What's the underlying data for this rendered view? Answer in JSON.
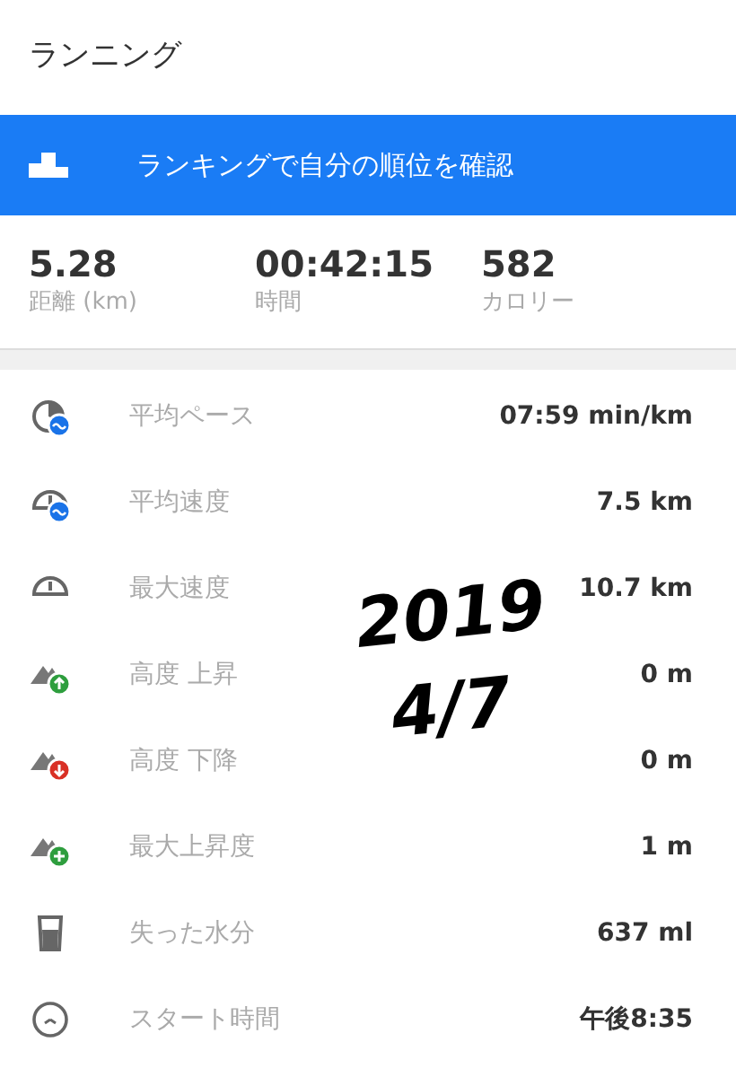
{
  "header": {
    "title": "ランニング"
  },
  "banner": {
    "text": "ランキングで自分の順位を確認"
  },
  "summary": [
    {
      "value": "5.28",
      "label": "距離 (km)"
    },
    {
      "value": "00:42:15",
      "label": "時間"
    },
    {
      "value": "582",
      "label": "カロリー"
    }
  ],
  "stats": [
    {
      "kind": "pace",
      "label": "平均ペース",
      "value": "07:59 min/km"
    },
    {
      "kind": "avg-speed",
      "label": "平均速度",
      "value": "7.5 km"
    },
    {
      "kind": "max-speed",
      "label": "最大速度",
      "value": "10.7 km"
    },
    {
      "kind": "ascent",
      "label": "高度 上昇",
      "value": "0 m"
    },
    {
      "kind": "descent",
      "label": "高度 下降",
      "value": "0 m"
    },
    {
      "kind": "max-ascent",
      "label": "最大上昇度",
      "value": "1 m"
    },
    {
      "kind": "water",
      "label": "失った水分",
      "value": "637 ml"
    },
    {
      "kind": "clock",
      "label": "スタート時間",
      "value": "午後8:35"
    }
  ],
  "handwritten_note": [
    "2019",
    "4/7"
  ]
}
